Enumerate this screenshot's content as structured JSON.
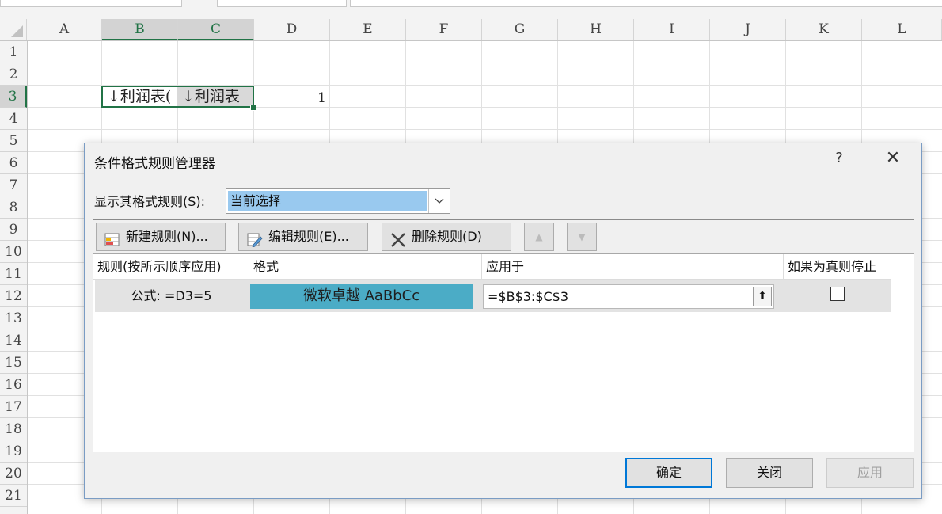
{
  "sheet": {
    "columns": [
      "A",
      "B",
      "C",
      "D",
      "E",
      "F",
      "G",
      "H",
      "I",
      "J",
      "K",
      "L"
    ],
    "selected_columns": [
      "B",
      "C"
    ],
    "rows": [
      "1",
      "2",
      "3",
      "4",
      "5",
      "6",
      "7",
      "8",
      "9",
      "10",
      "11",
      "12",
      "13",
      "14",
      "15",
      "16",
      "17",
      "18",
      "19",
      "20",
      "21"
    ],
    "selected_row": "3",
    "cells": {
      "B3": "↓利润表(",
      "C3": "↓利润表",
      "D3": "1"
    }
  },
  "dialog": {
    "title": "条件格式规则管理器",
    "help_label": "?",
    "close_label": "✕",
    "show_rules_label": "显示其格式规则(S):",
    "show_rules_value": "当前选择",
    "toolbar": {
      "new_rule": "新建规则(N)...",
      "edit_rule": "编辑规则(E)...",
      "delete_rule": "删除规则(D)",
      "move_up": "▲",
      "move_down": "▼"
    },
    "columns": {
      "rule": "规则(按所示顺序应用)",
      "format": "格式",
      "applies_to": "应用于",
      "stop_if_true": "如果为真则停止"
    },
    "rules": [
      {
        "rule": "公式: =D3=5",
        "format_preview": "微软卓越  AaBbCc",
        "format_color": "#4bacc6",
        "applies_to": "=$B$3:$C$3",
        "stop_if_true": false
      }
    ],
    "range_picker_icon": "⬆",
    "buttons": {
      "ok": "确定",
      "close": "关闭",
      "apply": "应用"
    }
  }
}
